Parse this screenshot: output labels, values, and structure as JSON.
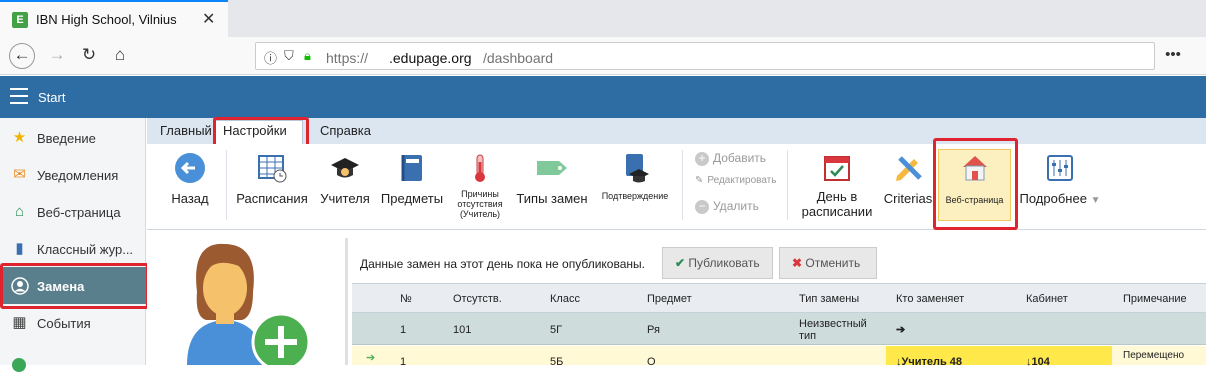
{
  "browser": {
    "tab_title": "IBN High School, Vilnius",
    "favicon_letter": "E",
    "url_scheme": "https://",
    "url_host": ".edupage.org",
    "url_path": "/dashboard"
  },
  "app": {
    "header_title": "Start"
  },
  "sidebar": {
    "items": [
      {
        "label": "Введение",
        "icon": "star-icon"
      },
      {
        "label": "Уведомления",
        "icon": "envelope-icon"
      },
      {
        "label": "Веб-страница",
        "icon": "home-icon"
      },
      {
        "label": "Классный жур...",
        "icon": "book-icon"
      },
      {
        "label": "Замена",
        "icon": "user-icon",
        "active": true
      },
      {
        "label": "События",
        "icon": "calendar-icon"
      }
    ]
  },
  "ribbon": {
    "tabs": [
      "Главный",
      "Настройки",
      "Справка"
    ],
    "active_tab": "Настройки",
    "buttons": {
      "back": "Назад",
      "schedule": "Расписания",
      "teachers": "Учителя",
      "subjects": "Предметы",
      "absence_reasons": "Причины отсутствия (Учитель)",
      "sub_types": "Типы замен",
      "confirmation": "Подтверждение",
      "add": "Добавить",
      "edit": "Редактировать",
      "delete": "Удалить",
      "day_in_schedule": "День в расписании",
      "criterias": "Criterias",
      "web_page": "Веб-страница",
      "more": "Подробнее"
    }
  },
  "content": {
    "notice": "Данные замен на этот день пока не опубликованы.",
    "publish_button": "Публиковать",
    "cancel_button": "Отменить",
    "table": {
      "headers": [
        "№",
        "Отсутств.",
        "Класс",
        "Предмет",
        "Тип замены",
        "Кто заменяет",
        "Кабинет",
        "Примечание"
      ],
      "rows": [
        [
          "1",
          "101",
          "5Г",
          "Ря",
          "Неизвестный тип",
          "➔",
          "",
          ""
        ],
        [
          "1",
          "",
          "5Б",
          "О",
          "",
          "↓Учитель 48",
          "↓104",
          "Перемещено"
        ]
      ]
    }
  },
  "colors": {
    "header_blue": "#2e6da4",
    "sidebar_active": "#5a7f8c",
    "highlight_red": "#e0242f",
    "row_teal": "#cfdcdc",
    "row_yellow": "#fff9d6"
  }
}
